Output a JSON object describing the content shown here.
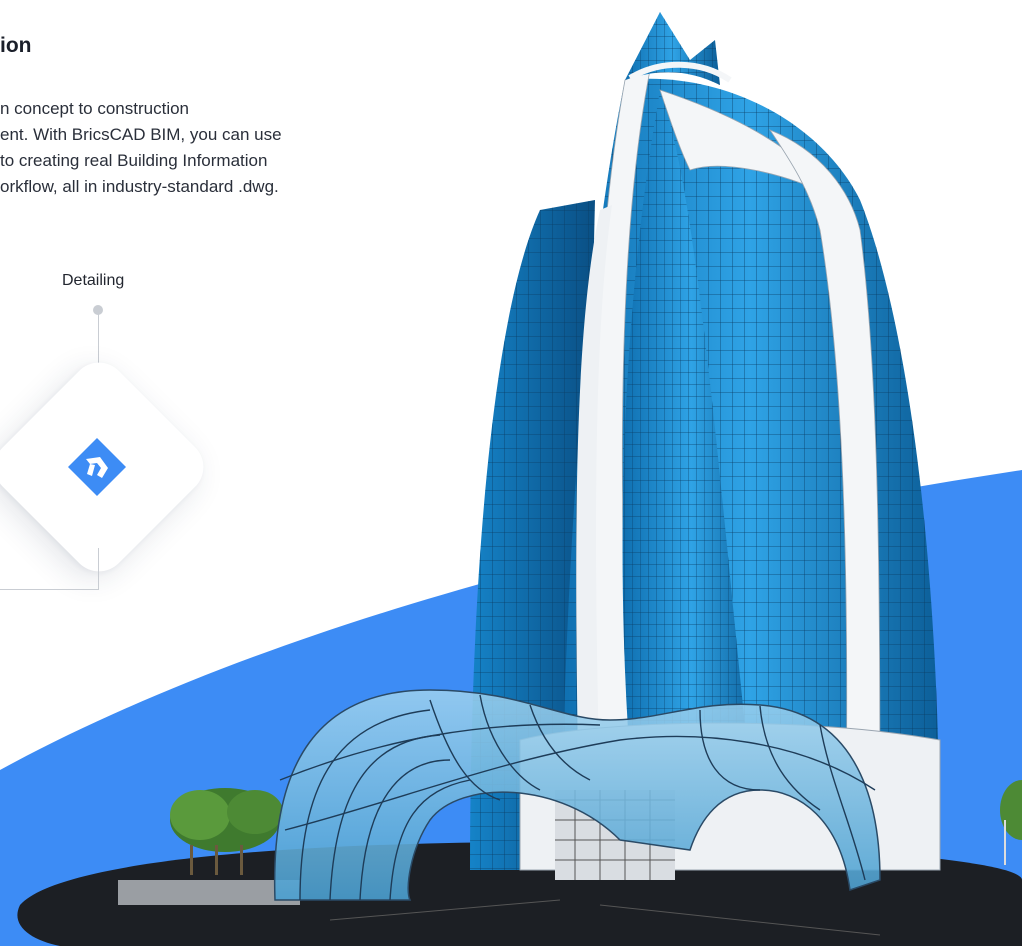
{
  "intro": {
    "heading": "ion",
    "paragraph_lines": [
      "n concept to construction",
      "ent. With BricsCAD BIM, you can use",
      "to creating real Building Information",
      "orkflow, all in industry-standard .dwg."
    ]
  },
  "workflow": {
    "node_label": "Detailing",
    "node_icon": "bricscad-logo-icon"
  },
  "colors": {
    "accent_blue": "#3d8cf5",
    "glass_blue": "#1f8fd6",
    "frame_white": "#f4f6f8"
  },
  "scene": {
    "description_icon": "building-render-image"
  }
}
